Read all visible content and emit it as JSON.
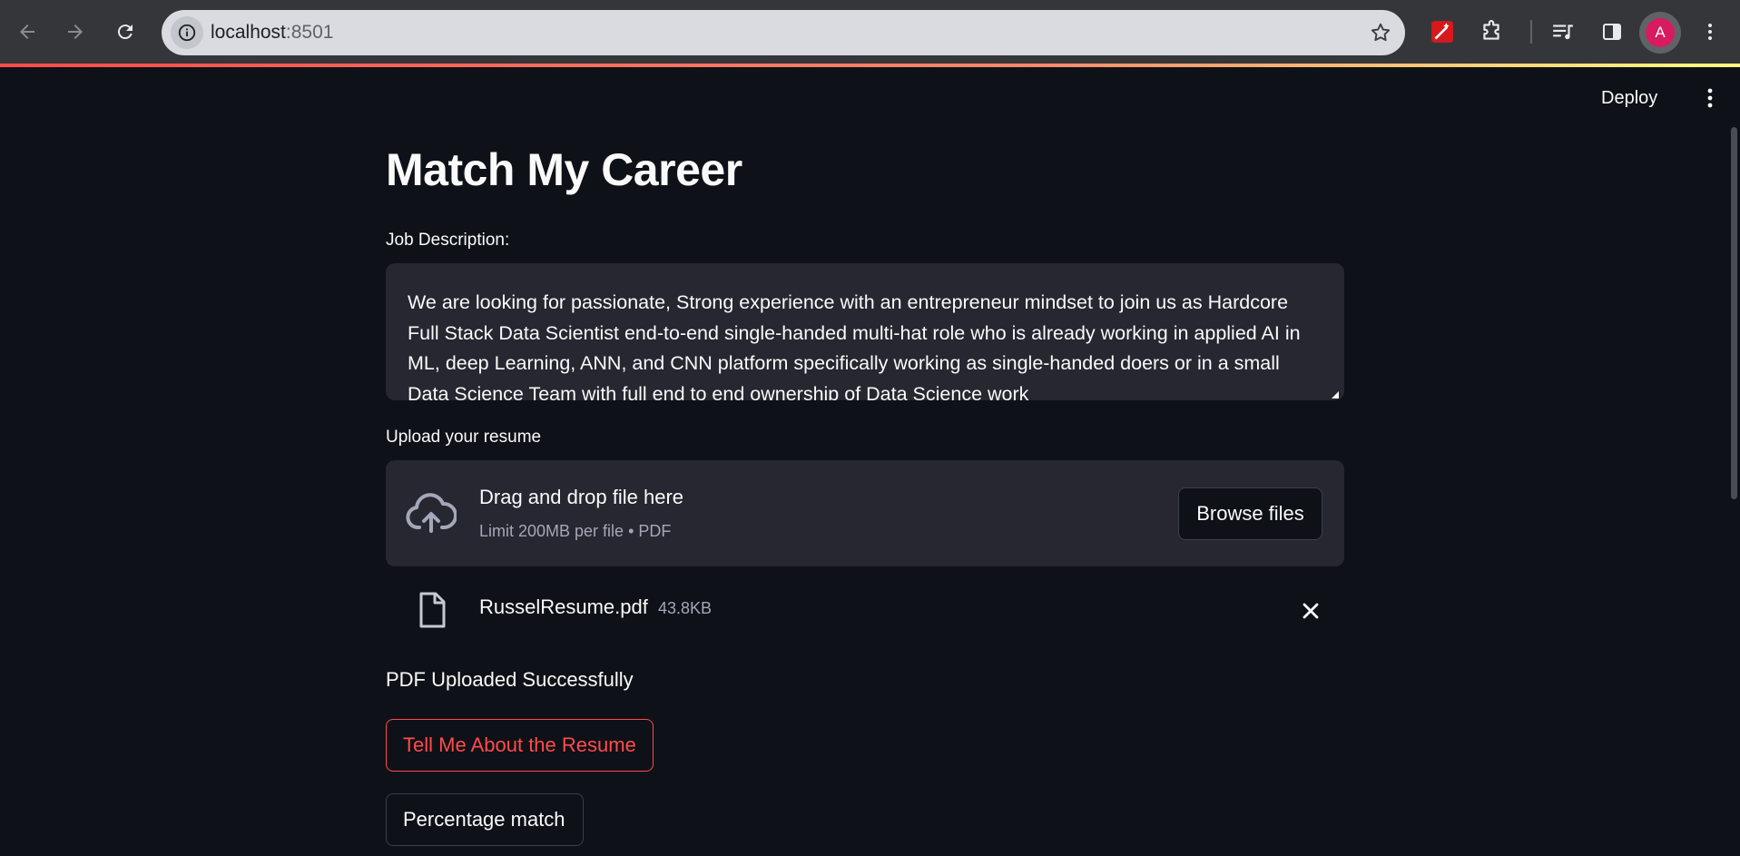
{
  "browser": {
    "url_host": "localhost",
    "url_port": ":8501",
    "profile_initial": "A"
  },
  "app": {
    "deploy_label": "Deploy",
    "title": "Match My Career"
  },
  "job_description": {
    "label": "Job Description:",
    "value": "We are looking for passionate, Strong experience with an entrepreneur mindset to join us as Hardcore Full Stack Data Scientist end-to-end single-handed multi-hat role who is already working in applied AI in ML, deep Learning, ANN, and CNN platform specifically working as single-handed doers or in a small Data Science Team with full end to end ownership of Data Science work"
  },
  "uploader": {
    "label": "Upload your resume",
    "drag_text": "Drag and drop file here",
    "limit_text": "Limit 200MB per file • PDF",
    "browse_label": "Browse files",
    "file_name": "RusselResume.pdf",
    "file_size": "43.8KB"
  },
  "status": {
    "message": "PDF Uploaded Successfully"
  },
  "actions": {
    "resume_label": "Tell Me About the Resume",
    "match_label": "Percentage match"
  }
}
